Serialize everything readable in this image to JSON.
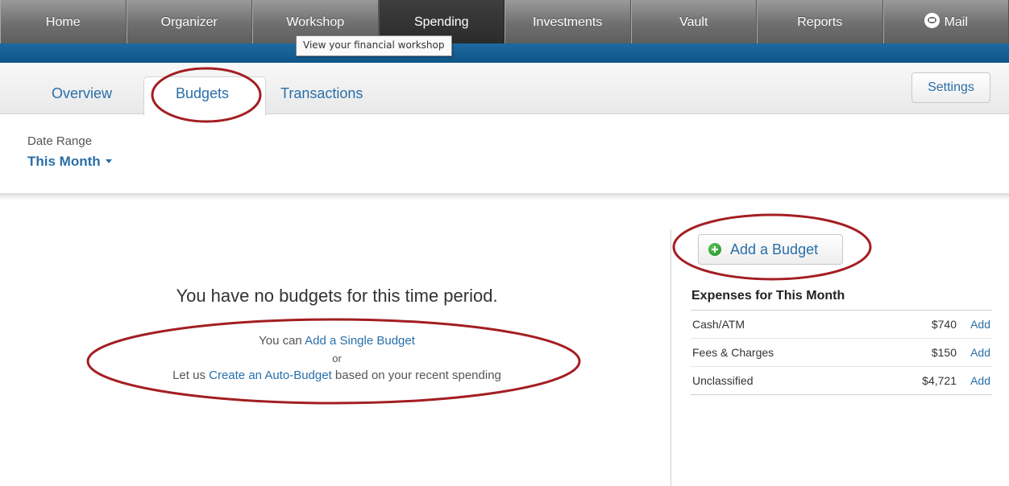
{
  "topnav": {
    "items": [
      {
        "label": "Home"
      },
      {
        "label": "Organizer"
      },
      {
        "label": "Workshop"
      },
      {
        "label": "Spending"
      },
      {
        "label": "Investments"
      },
      {
        "label": "Vault"
      },
      {
        "label": "Reports"
      },
      {
        "label": "Mail",
        "icon": "mail-icon"
      }
    ],
    "active": "Spending",
    "tooltip": "View your financial workshop",
    "colors": {
      "bar": "#6f6f6f",
      "active": "#2b2b2b",
      "band": "#1d6aa0"
    }
  },
  "tabs": {
    "items": [
      {
        "label": "Overview"
      },
      {
        "label": "Budgets"
      },
      {
        "label": "Transactions"
      }
    ],
    "active": "Budgets",
    "settings_label": "Settings"
  },
  "date_range": {
    "label": "Date Range",
    "value": "This Month",
    "icon": "caret-down-icon"
  },
  "empty_state": {
    "title": "You have no budgets for this time period.",
    "line1_prefix": "You can ",
    "line1_link": "Add a Single Budget",
    "or": "or",
    "line3_prefix": "Let us ",
    "line3_link": "Create an Auto-Budget",
    "line3_suffix": " based on your recent spending"
  },
  "sidebar": {
    "add_budget_label": "Add a Budget",
    "add_budget_icon": "plus-circle-icon",
    "expenses_title": "Expenses for This Month",
    "expenses": [
      {
        "name": "Cash/ATM",
        "amount": "$740",
        "action": "Add"
      },
      {
        "name": "Fees & Charges",
        "amount": "$150",
        "action": "Add"
      },
      {
        "name": "Unclassified",
        "amount": "$4,721",
        "action": "Add"
      }
    ]
  },
  "colors": {
    "link": "#2a6fa8",
    "annotation": "#a31e22",
    "add_icon": "#2e9e2e"
  }
}
